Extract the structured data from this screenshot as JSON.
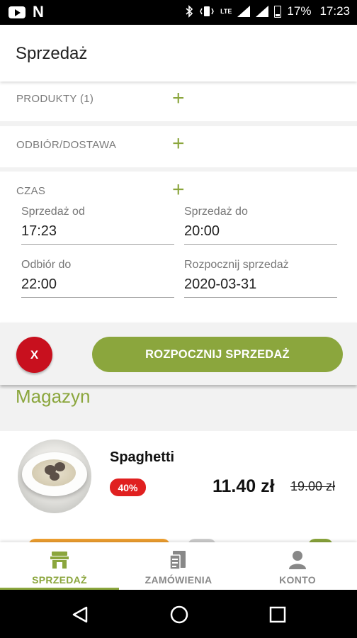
{
  "status_bar": {
    "battery": "17%",
    "time": "17:23",
    "network": "LTE"
  },
  "header": {
    "title": "Sprzedaż"
  },
  "sections": {
    "products": "PRODUKTY (1)",
    "delivery": "ODBIÓR/DOSTAWA",
    "time": "CZAS"
  },
  "time_fields": {
    "sale_from_label": "Sprzedaż od",
    "sale_from_value": "17:23",
    "sale_to_label": "Sprzedaż do",
    "sale_to_value": "20:00",
    "pickup_to_label": "Odbiór do",
    "pickup_to_value": "22:00",
    "start_sale_label": "Rozpocznij sprzedaż",
    "start_sale_value": "2020-03-31"
  },
  "actions": {
    "cancel_label": "X",
    "start_label": "ROZPOCZNIJ SPRZEDAŻ"
  },
  "magazyn": {
    "title": "Magazyn",
    "products": [
      {
        "name": "Spaghetti",
        "discount": "40%",
        "price": "11.40 zł",
        "old_price": "19.00 zł"
      }
    ]
  },
  "bottom_nav": {
    "items": [
      {
        "label": "SPRZEDAŻ",
        "icon": "store-icon",
        "active": true
      },
      {
        "label": "ZAMÓWIENIA",
        "icon": "orders-icon",
        "active": false
      },
      {
        "label": "KONTO",
        "icon": "account-icon",
        "active": false
      }
    ]
  },
  "colors": {
    "accent": "#8ba63d",
    "danger": "#c8101e",
    "badge": "#e02020"
  }
}
